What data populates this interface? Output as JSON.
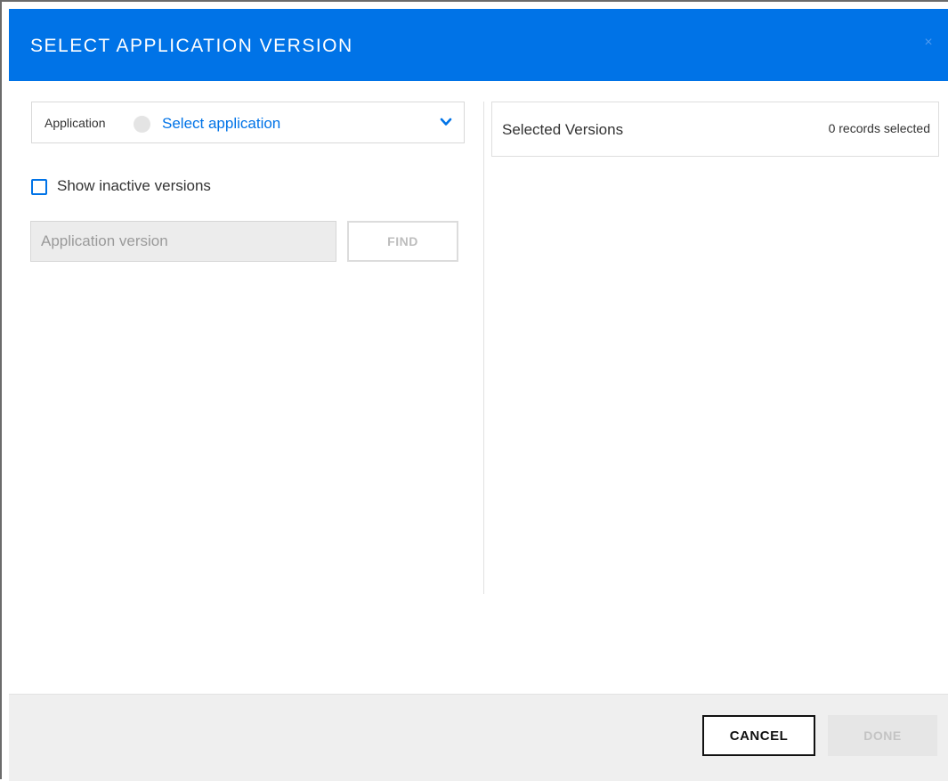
{
  "dialog": {
    "title": "SELECT APPLICATION VERSION",
    "close_glyph": "×",
    "accent_color": "#0073e7"
  },
  "app_select": {
    "label": "Application",
    "value": "Select application",
    "dropdown_icon": "chevron-down-icon"
  },
  "filters": {
    "show_inactive_label": "Show inactive versions",
    "show_inactive_checked": false
  },
  "search": {
    "placeholder": "Application version",
    "find_label": "FIND"
  },
  "selected": {
    "title": "Selected Versions",
    "count_text": "0 records selected"
  },
  "footer": {
    "cancel_label": "CANCEL",
    "done_label": "DONE"
  }
}
